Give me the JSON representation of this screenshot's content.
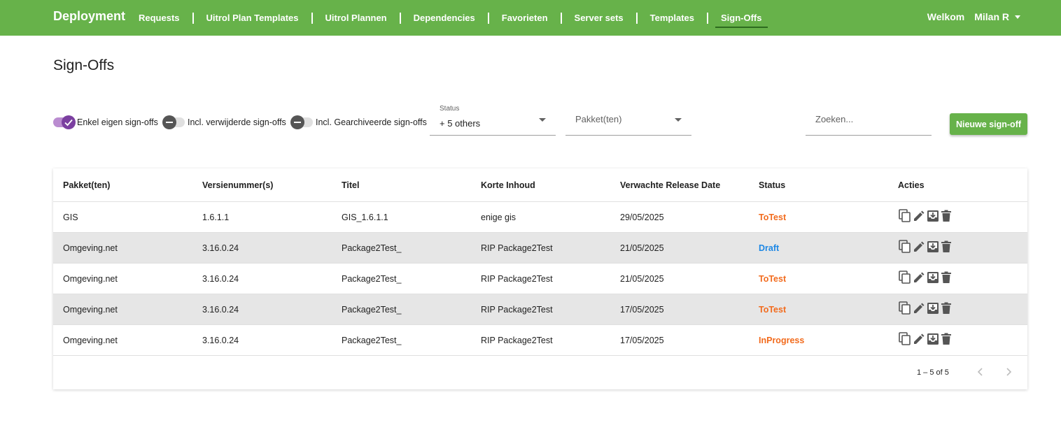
{
  "header": {
    "brand": "Deployment",
    "nav": [
      {
        "label": "Requests"
      },
      {
        "label": "Uitrol Plan Templates"
      },
      {
        "label": "Uitrol Plannen"
      },
      {
        "label": "Dependencies"
      },
      {
        "label": "Favorieten"
      },
      {
        "label": "Server sets"
      },
      {
        "label": "Templates"
      },
      {
        "label": "Sign-Offs"
      }
    ],
    "active_nav": "Sign-Offs",
    "welcome": "Welkom",
    "user": "Milan R"
  },
  "page": {
    "title": "Sign-Offs"
  },
  "filters": {
    "toggles": [
      {
        "label": "Enkel eigen sign-offs",
        "on": true
      },
      {
        "label": "Incl. verwijderde sign-offs",
        "on": false
      },
      {
        "label": "Incl. Gearchiveerde sign-offs",
        "on": false
      }
    ],
    "status_label": "Status",
    "status_value": "+ 5 others",
    "package_placeholder": "Pakket(ten)",
    "search_placeholder": "Zoeken...",
    "new_button": "Nieuwe sign-off"
  },
  "table": {
    "columns": [
      "Pakket(ten)",
      "Versienummer(s)",
      "Titel",
      "Korte Inhoud",
      "Verwachte Release Date",
      "Status",
      "Acties"
    ],
    "rows": [
      {
        "package": "GIS",
        "version": "1.6.1.1",
        "title": "GIS_1.6.1.1",
        "content": "enige gis",
        "release": "29/05/2025",
        "status": "ToTest"
      },
      {
        "package": "Omgeving.net",
        "version": "3.16.0.24",
        "title": "Package2Test_",
        "content": "RIP Package2Test",
        "release": "21/05/2025",
        "status": "Draft"
      },
      {
        "package": "Omgeving.net",
        "version": "3.16.0.24",
        "title": "Package2Test_",
        "content": "RIP Package2Test",
        "release": "21/05/2025",
        "status": "ToTest"
      },
      {
        "package": "Omgeving.net",
        "version": "3.16.0.24",
        "title": "Package2Test_",
        "content": "RIP Package2Test",
        "release": "17/05/2025",
        "status": "ToTest"
      },
      {
        "package": "Omgeving.net",
        "version": "3.16.0.24",
        "title": "Package2Test_",
        "content": "RIP Package2Test",
        "release": "17/05/2025",
        "status": "InProgress"
      }
    ],
    "status_colors": {
      "ToTest": "#f26b1d",
      "Draft": "#1e88e5",
      "InProgress": "#f26b1d"
    },
    "action_icons": [
      "copy-icon",
      "edit-icon",
      "archive-icon",
      "delete-icon"
    ],
    "pagination": "1 – 5 of 5"
  },
  "colors": {
    "primary": "#67b24a",
    "toggle_on": "#7b3fa0"
  }
}
